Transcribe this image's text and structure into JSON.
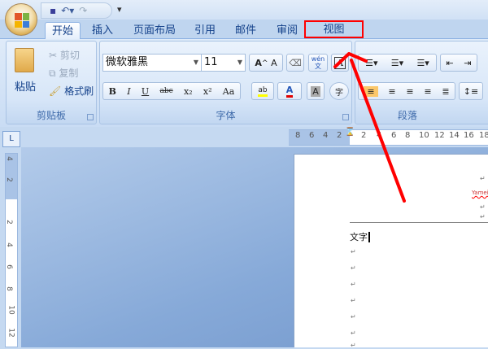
{
  "quick_access": {
    "save_icon": "save-icon",
    "undo_icon": "undo-icon",
    "redo_icon": "redo-icon",
    "customize": "▾"
  },
  "tabs": [
    {
      "label": "开始",
      "active": true
    },
    {
      "label": "插入"
    },
    {
      "label": "页面布局"
    },
    {
      "label": "引用"
    },
    {
      "label": "邮件"
    },
    {
      "label": "审阅"
    },
    {
      "label": "视图",
      "highlighted": true
    }
  ],
  "clipboard": {
    "label": "剪贴板",
    "paste": "粘贴",
    "cut": "剪切",
    "copy": "复制",
    "format_painter": "格式刷"
  },
  "font": {
    "label": "字体",
    "name": "微软雅黑",
    "size": "11",
    "bold": "B",
    "italic": "I",
    "underline": "U",
    "strike": "abc",
    "subscript": "x₂",
    "superscript": "x²",
    "change_case": "Aa",
    "grow": "A^",
    "shrink": "Aˇ",
    "clear": "A",
    "phonetic": "wén 文",
    "border": "A",
    "shading": "A",
    "enclose": "字",
    "highlight_color": "#ffff00",
    "font_color": "#e00000"
  },
  "paragraph": {
    "label": "段落"
  },
  "ruler": {
    "h_ticks": [
      "8",
      "6",
      "4",
      "2",
      "2",
      "4",
      "6",
      "8",
      "10",
      "12",
      "14",
      "16",
      "18"
    ],
    "v_ticks": [
      "4",
      "2",
      "2",
      "4",
      "6",
      "8",
      "10",
      "12"
    ]
  },
  "document": {
    "text": "文字",
    "header_text": "Yamei"
  },
  "annotation": {
    "color": "#ff0000"
  }
}
